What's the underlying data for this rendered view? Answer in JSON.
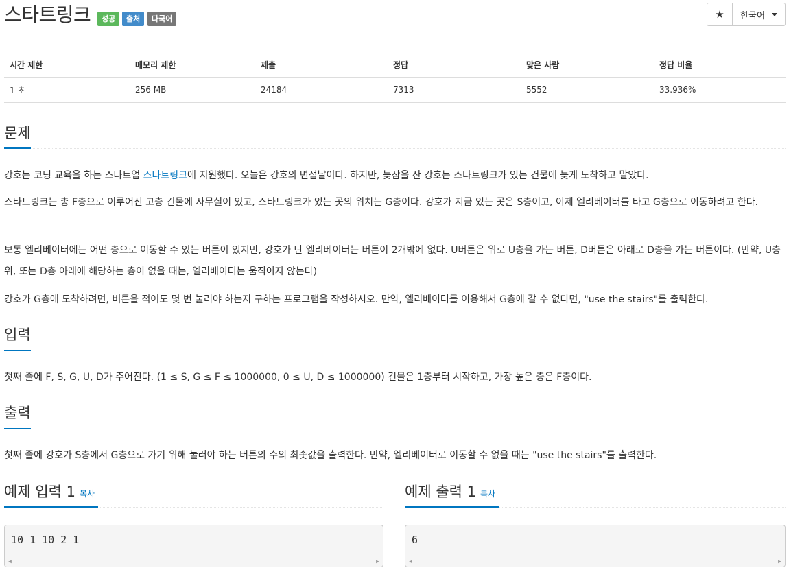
{
  "header": {
    "title": "스타트링크",
    "badges": [
      {
        "label": "성공",
        "color": "#5cb85c"
      },
      {
        "label": "출처",
        "color": "#428bca"
      },
      {
        "label": "다국어",
        "color": "#777777"
      }
    ],
    "star_icon": "★",
    "language": "한국어"
  },
  "info_table": {
    "headers": [
      "시간 제한",
      "메모리 제한",
      "제출",
      "정답",
      "맞은 사람",
      "정답 비율"
    ],
    "values": [
      "1 초",
      "256 MB",
      "24184",
      "7313",
      "5552",
      "33.936%"
    ]
  },
  "sections": {
    "problem": {
      "title": "문제",
      "p1_before": "강호는 코딩 교육을 하는 스타트업 ",
      "p1_link": "스타트링크",
      "p1_after": "에 지원했다. 오늘은 강호의 면접날이다. 하지만, 늦잠을 잔 강호는 스타트링크가 있는 건물에 늦게 도착하고 말았다.",
      "p2": "스타트링크는 총 F층으로 이루어진 고층 건물에 사무실이 있고, 스타트링크가 있는 곳의 위치는 G층이다. 강호가 지금 있는 곳은 S층이고, 이제 엘리베이터를 타고 G층으로 이동하려고 한다.",
      "p3": "보통 엘리베이터에는 어떤 층으로 이동할 수 있는 버튼이 있지만, 강호가 탄 엘리베이터는 버튼이 2개밖에 없다. U버튼은 위로 U층을 가는 버튼, D버튼은 아래로 D층을 가는 버튼이다. (만약, U층 위, 또는 D층 아래에 해당하는 층이 없을 때는, 엘리베이터는 움직이지 않는다)",
      "p4": "강호가 G층에 도착하려면, 버튼을 적어도 몇 번 눌러야 하는지 구하는 프로그램을 작성하시오. 만약, 엘리베이터를 이용해서 G층에 갈 수 없다면, \"use the stairs\"를 출력한다."
    },
    "input": {
      "title": "입력",
      "text": "첫째 줄에 F, S, G, U, D가 주어진다. (1 ≤ S, G ≤ F ≤ 1000000, 0 ≤ U, D ≤ 1000000) 건물은 1층부터 시작하고, 가장 높은 층은 F층이다."
    },
    "output": {
      "title": "출력",
      "text": "첫째 줄에 강호가 S층에서 G층으로 가기 위해 눌러야 하는 버튼의 수의 최솟값을 출력한다. 만약, 엘리베이터로 이동할 수 없을 때는 \"use the stairs\"를 출력한다."
    },
    "sample_input": {
      "title": "예제 입력 1",
      "copy": "복사",
      "content": "10 1 10 2 1"
    },
    "sample_output": {
      "title": "예제 출력 1",
      "copy": "복사",
      "content": "6"
    }
  },
  "colors": {
    "accent": "#0076c0",
    "success": "#5cb85c",
    "submit": "#428bca",
    "multi": "#777777"
  }
}
